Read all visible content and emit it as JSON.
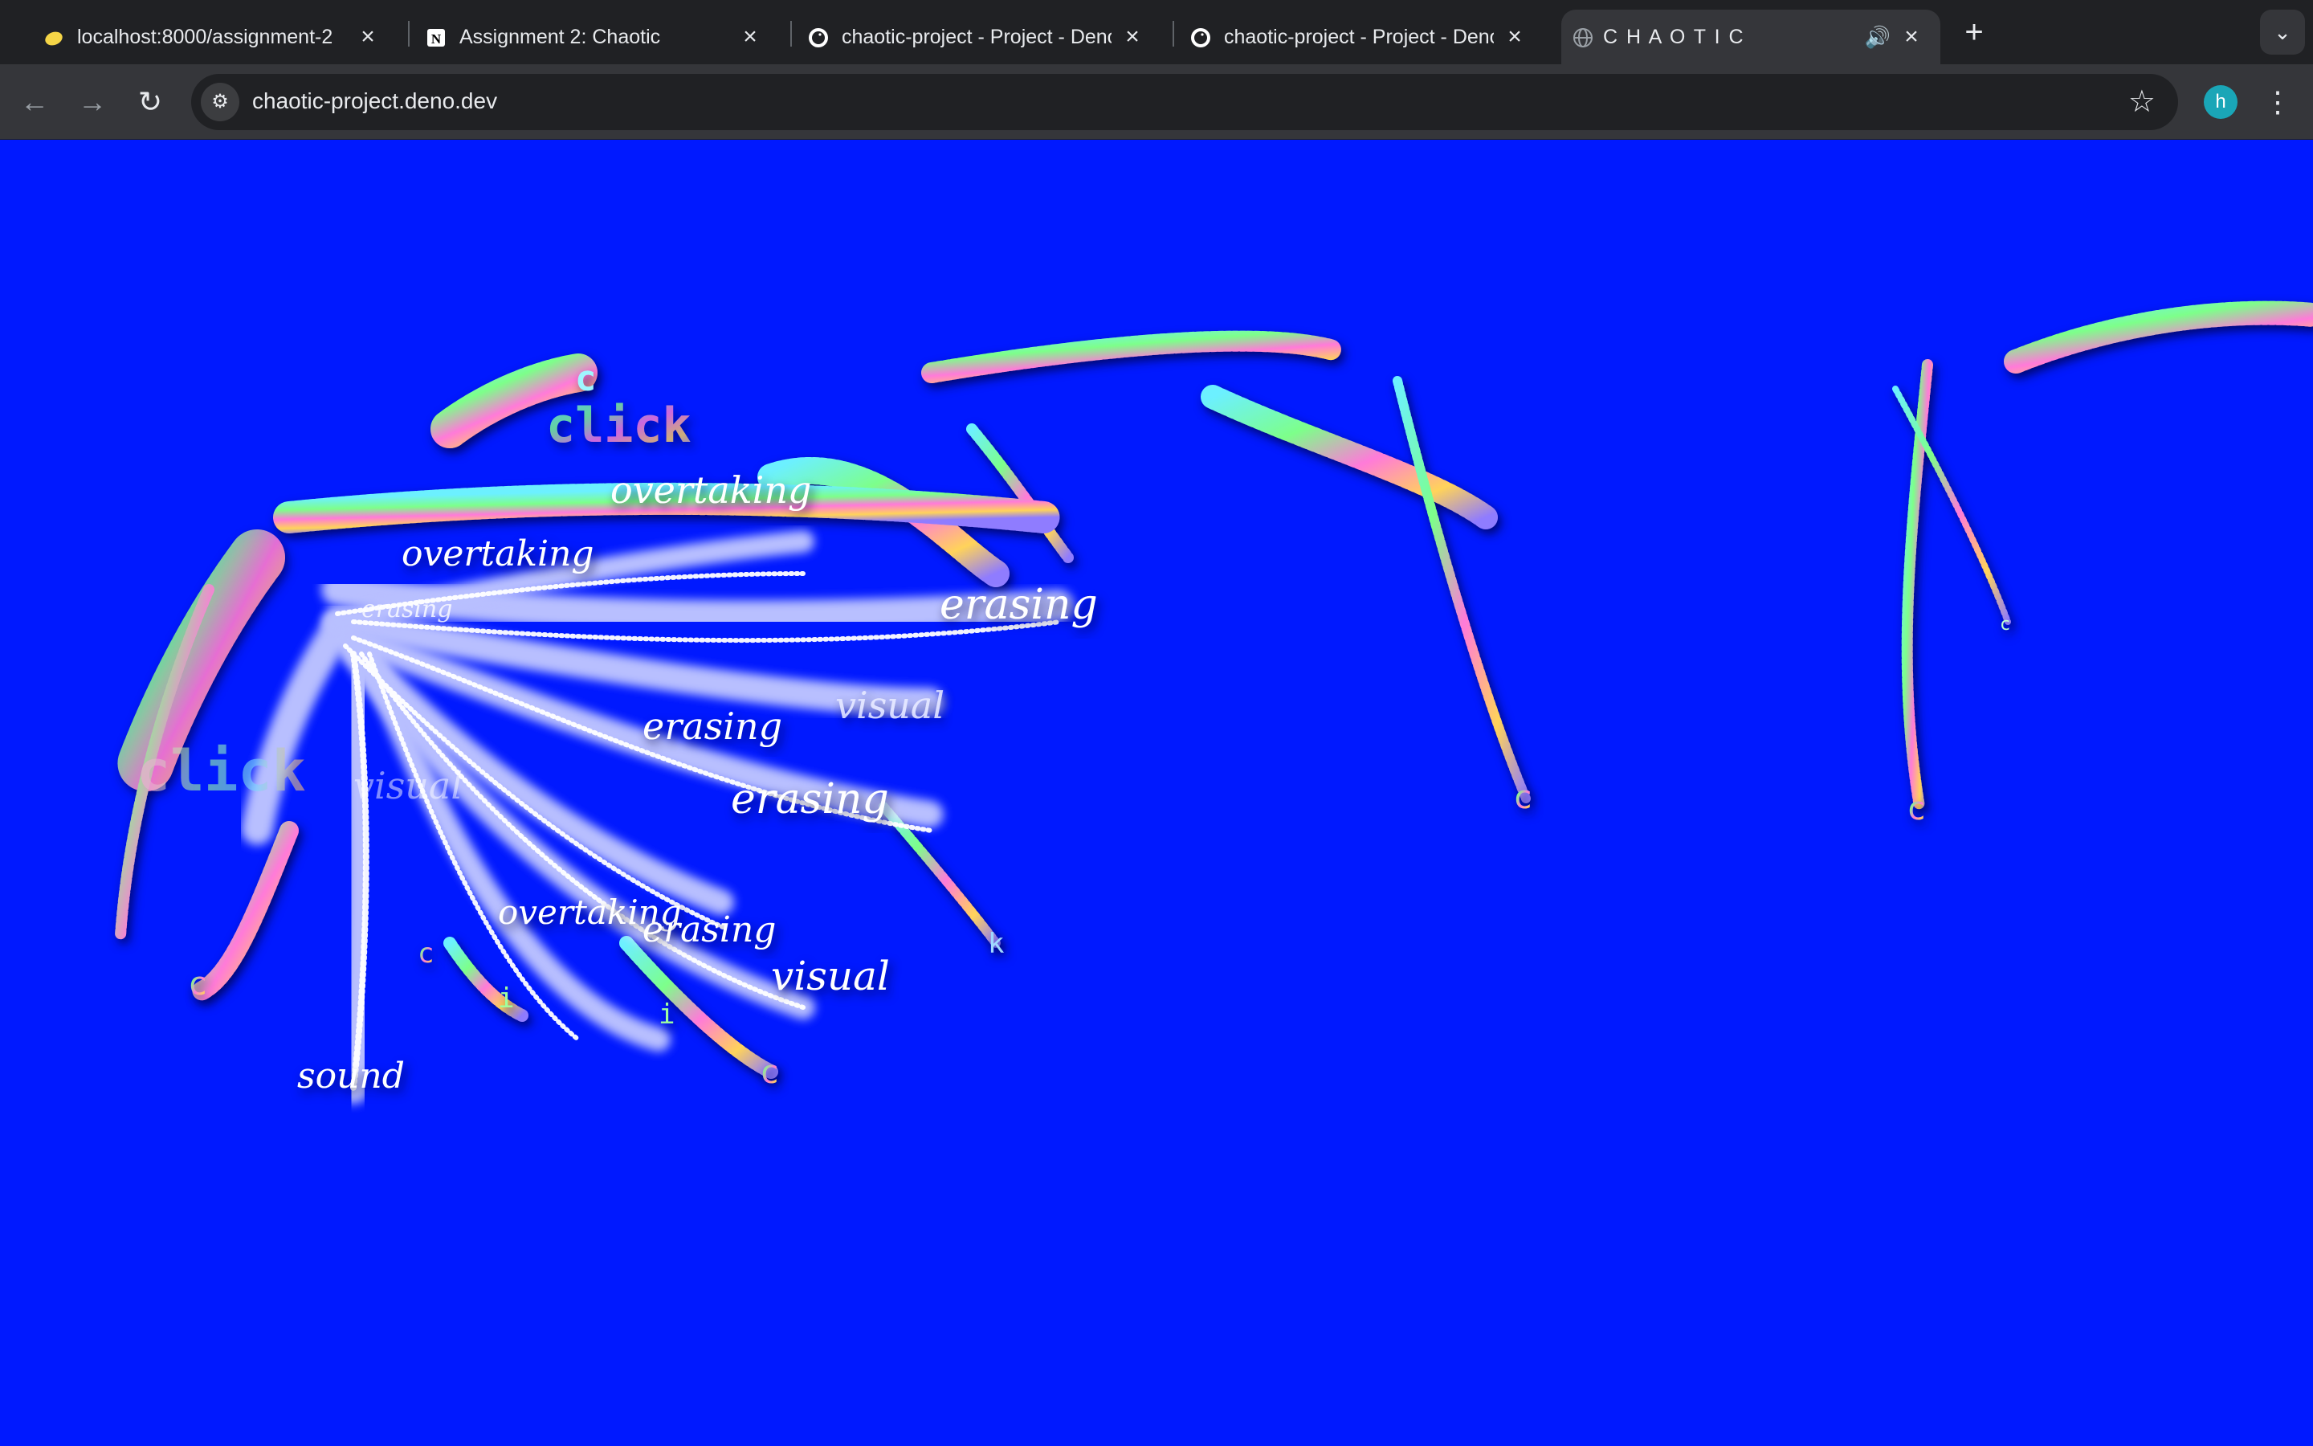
{
  "browser": {
    "tabs": [
      {
        "title": "localhost:8000/assignment-2",
        "favicon": "lemon-icon",
        "active": false
      },
      {
        "title": "Assignment 2: Chaotic",
        "favicon": "notion-icon",
        "active": false
      },
      {
        "title": "chaotic-project - Project - Deno Deploy",
        "favicon": "deno-icon",
        "active": false
      },
      {
        "title": "chaotic-project - Project - Deno Deploy",
        "favicon": "deno-icon",
        "active": false
      },
      {
        "title": "C H A O T I C",
        "favicon": "globe-icon",
        "active": true,
        "audio": "speaker-icon"
      }
    ],
    "new_tab": "+",
    "tab_search": "⌄",
    "url": "chaotic-project.deno.dev",
    "profile_initial": "h"
  },
  "canvas": {
    "background": "#0019ff",
    "words": [
      "click",
      "overtaking",
      "overtaking",
      "overtaking",
      "erasing",
      "erasing",
      "erasing",
      "erasing",
      "erasing",
      "visual",
      "visual",
      "visual",
      "sound",
      "click"
    ],
    "glyphs": [
      "c",
      "c",
      "c",
      "c",
      "c",
      "c",
      "c",
      "k",
      "i",
      "i"
    ]
  }
}
